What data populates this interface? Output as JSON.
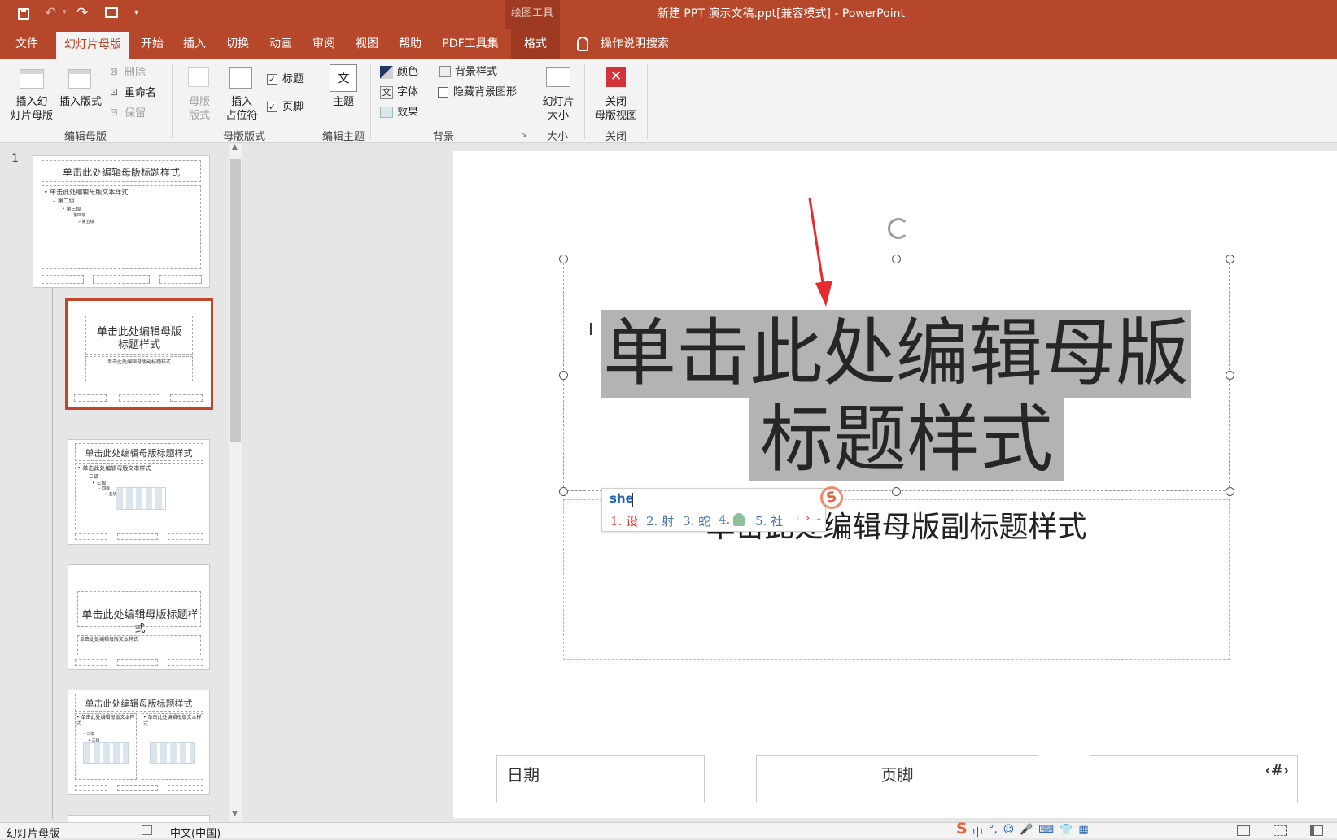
{
  "window": {
    "title": "新建 PPT 演示文稿.ppt[兼容模式]  -  PowerPoint",
    "context_group": "绘图工具"
  },
  "tabs": [
    "文件",
    "幻灯片母版",
    "开始",
    "插入",
    "切换",
    "动画",
    "审阅",
    "视图",
    "帮助",
    "PDF工具集",
    "格式"
  ],
  "tell_me": "操作说明搜索",
  "ribbon": {
    "insert_master": "插入幻\n灯片母版",
    "insert_layout": "插入版式",
    "delete": "删除",
    "rename": "重命名",
    "preserve": "保留",
    "group_edit_master": "编辑母版",
    "master_layout": "母版\n版式",
    "insert_placeholder": "插入\n占位符",
    "title_chk": "标题",
    "footer_chk": "页脚",
    "group_master_layout": "母版版式",
    "theme": "主题",
    "group_edit_theme": "编辑主题",
    "colors": "颜色",
    "fonts": "字体",
    "effects": "效果",
    "bg_styles": "背景样式",
    "hide_bg": "隐藏背景图形",
    "group_background": "背景",
    "slide_size": "幻灯片\n大小",
    "group_size": "大小",
    "close_master": "关闭\n母版视图",
    "group_close": "关闭"
  },
  "thumbs": {
    "num": "1",
    "t1_title": "单击此处编辑母版标题样式",
    "t1_l1": "• 单击此处编辑母版文本样式",
    "t1_l2": "– 第二级",
    "t1_l3": "• 第三级",
    "t1_l4": "– 第四级",
    "t1_l5": "» 第五级",
    "t2_title": "单击此处编辑母版标题样式",
    "t2_sub": "单击此处编辑母版副标题样式",
    "t3_title": "单击此处编辑母版标题样式",
    "t3_l1": "• 单击此处编辑母版文本样式",
    "t3_l2": "– 二级",
    "t3_l3": "• 三级",
    "t3_l4": "– 四级",
    "t3_l5": "» 五级",
    "t4_title": "单击此处编辑母版标题样式",
    "t4_sub": "单击此处编辑母版文本样式",
    "t5_title": "单击此处编辑母版标题样式",
    "t5_left": "• 单击此处编辑母版文本样式",
    "t5_right": "• 单击此处编辑母版文本样式",
    "t5_l2": "– 二级",
    "t5_l3": "• 三级"
  },
  "slide": {
    "title_line1": "单击此处编辑母版",
    "title_line2": "标题样式",
    "subtitle": "单击此处编辑母版副标题样式",
    "date": "日期",
    "footer": "页脚",
    "page_num": "‹#›"
  },
  "ime": {
    "input": "she",
    "cand1": "1. 设",
    "cand2": "2. 射",
    "cand3": "3. 蛇",
    "cand4": "4.",
    "cand5": "5. 社",
    "logo": "S"
  },
  "status": {
    "view": "幻灯片母版",
    "lang": "中文(中国)",
    "tray": [
      "中",
      "°,",
      "☺",
      "🎤",
      "⌨",
      "👕",
      "▦"
    ]
  }
}
